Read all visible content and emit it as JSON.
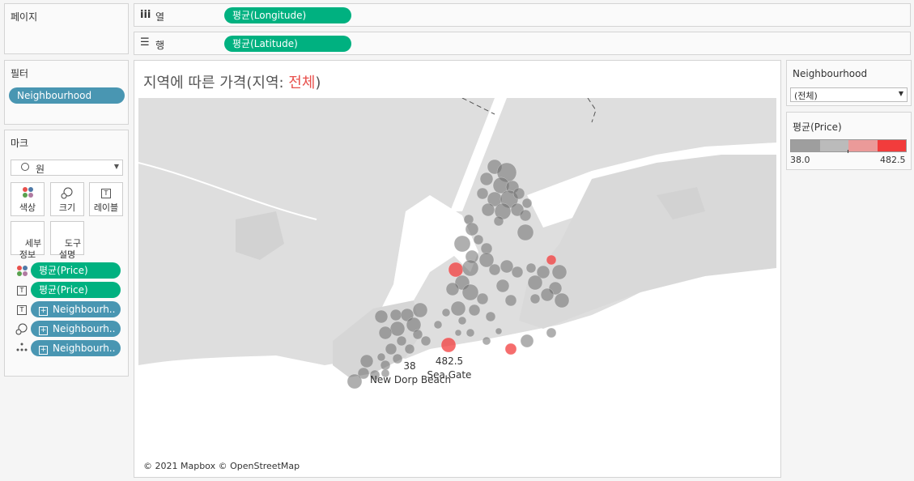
{
  "pages_panel": {
    "title": "페이지"
  },
  "columns_shelf": {
    "icon": "iii",
    "label": "열",
    "pill": "평균(Longitude)"
  },
  "rows_shelf": {
    "icon": "☰",
    "label": "행",
    "pill": "평균(Latitude)"
  },
  "filters_panel": {
    "title": "필터",
    "pill": "Neighbourhood"
  },
  "marks_panel": {
    "title": "마크",
    "mark_type": "원",
    "buttons": {
      "color": "색상",
      "size": "크기",
      "label": "레이블",
      "detail": "세부\n정보",
      "tooltip": "도구\n설명"
    },
    "fields": [
      {
        "icon": "color-icon",
        "label": "평균(Price)",
        "color": "green"
      },
      {
        "icon": "text-label-icon",
        "label": "평균(Price)",
        "color": "green"
      },
      {
        "icon": "text-label-icon",
        "label": "Neighbourh..",
        "color": "blue"
      },
      {
        "icon": "size-icon",
        "label": "Neighbourh..",
        "color": "blue"
      },
      {
        "icon": "detail-icon",
        "label": "Neighbourh..",
        "color": "blue"
      }
    ]
  },
  "chart": {
    "title_prefix": "지역에 따른 가격(지역: ",
    "title_highlight": "전체",
    "title_suffix": ")",
    "attribution": "© 2021 Mapbox © OpenStreetMap"
  },
  "chart_data": {
    "type": "scatter",
    "title": "지역에 따른 가격(지역: 전체)",
    "x_field": "평균(Longitude)",
    "y_field": "평균(Latitude)",
    "color_field": "평균(Price)",
    "color_range": [
      38.0,
      482.5
    ],
    "labeled_points": [
      {
        "name": "New Dorp Beach",
        "value": 38.0
      },
      {
        "name": "Sea Gate",
        "value": 482.5
      }
    ]
  },
  "neighbourhood_filter": {
    "title": "Neighbourhood",
    "selected": "(전체)"
  },
  "price_legend": {
    "title": "평균(Price)",
    "min": "38.0",
    "max": "482.5",
    "colors": [
      "#9e9e9e",
      "#bbbbbb",
      "#eb9a99",
      "#f23c3c"
    ]
  }
}
